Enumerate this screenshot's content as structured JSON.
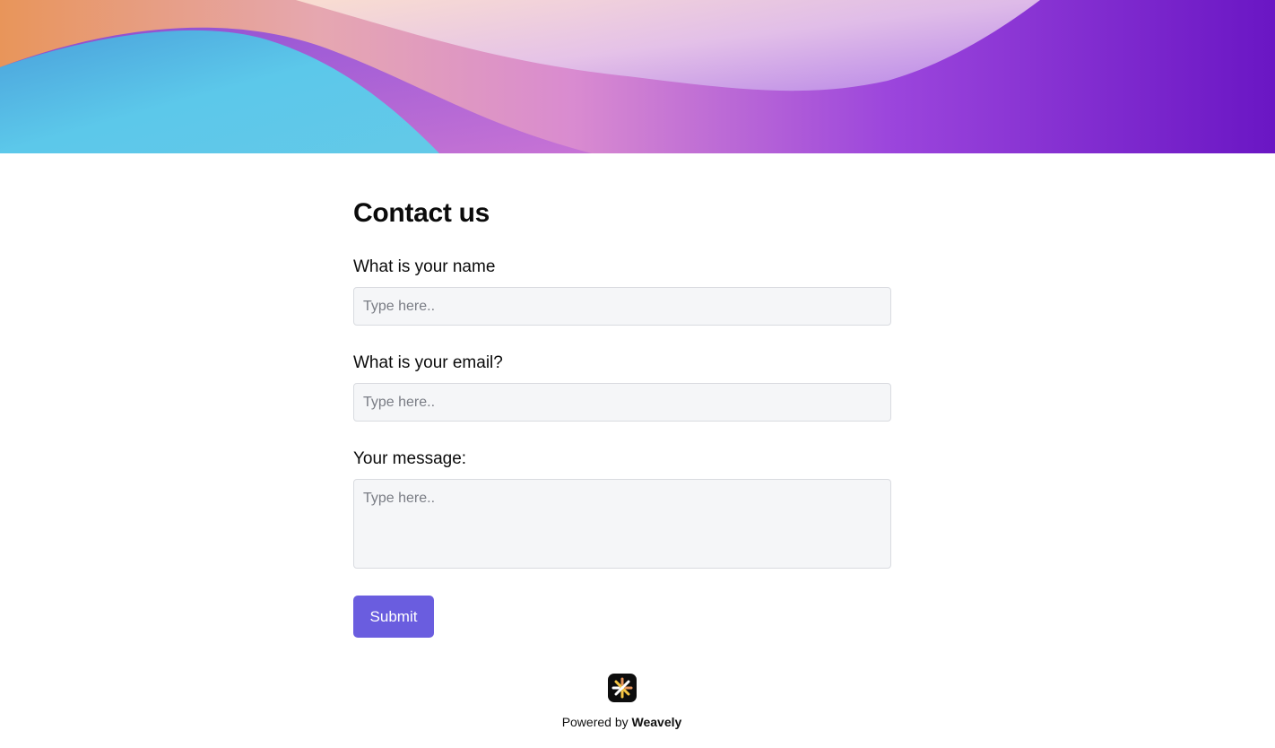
{
  "banner": {
    "colors": [
      "#e8955a",
      "#5cc8ea",
      "#d98bd0",
      "#8a3fe0",
      "#6a16c4"
    ]
  },
  "form": {
    "title": "Contact us",
    "questions": [
      {
        "label": "What is your name",
        "placeholder": "Type here.."
      },
      {
        "label": "What is your email?",
        "placeholder": "Type here.."
      },
      {
        "label": "Your message:",
        "placeholder": "Type here.."
      }
    ],
    "submit_label": "Submit",
    "accent_color": "#6a5ddf"
  },
  "footer": {
    "powered_prefix": "Powered by",
    "brand": "Weavely",
    "logo_icon": "weavely-logo-icon"
  }
}
